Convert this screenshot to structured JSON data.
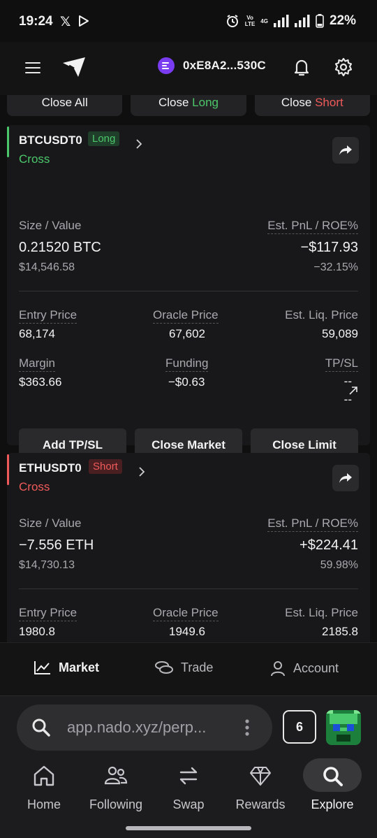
{
  "status_bar": {
    "time": "19:24",
    "x_icon": "x-logo-icon",
    "play_icon": "play-store-icon",
    "volte": "Vo\nLTE",
    "net": "4G",
    "battery": "22%"
  },
  "header": {
    "wallet_address": "0xE8A2...530C"
  },
  "close_bar": {
    "close_all": "Close All",
    "close_long_prefix": "Close ",
    "close_long_suffix": "Long",
    "close_short_prefix": "Close ",
    "close_short_suffix": "Short"
  },
  "positions": [
    {
      "symbol": "BTCUSDT0",
      "side": "Long",
      "margin_mode": "Cross",
      "size_label": "Size / Value",
      "size": "0.21520 BTC",
      "value": "$14,546.58",
      "pnl_label": "Est. PnL / ROE%",
      "pnl": "−$117.93",
      "roe": "−32.15%",
      "entry_label": "Entry Price",
      "entry": "68,174",
      "oracle_label": "Oracle Price",
      "oracle": "67,602",
      "liq_label": "Est. Liq. Price",
      "liq": "59,089",
      "margin_label": "Margin",
      "margin": "$363.66",
      "funding_label": "Funding",
      "funding": "−$0.63",
      "tpsl_label": "TP/SL",
      "tp": "--",
      "sl": "--",
      "add_tpsl": "Add TP/SL",
      "close_market": "Close Market",
      "close_limit": "Close Limit"
    },
    {
      "symbol": "ETHUSDT0",
      "side": "Short",
      "margin_mode": "Cross",
      "size_label": "Size / Value",
      "size": "−7.556 ETH",
      "value": "$14,730.13",
      "pnl_label": "Est. PnL / ROE%",
      "pnl": "+$224.41",
      "roe": "59.98%",
      "entry_label": "Entry Price",
      "entry": "1980.8",
      "oracle_label": "Oracle Price",
      "oracle": "1949.6",
      "liq_label": "Est. Liq. Price",
      "liq": "2185.8"
    }
  ],
  "app_nav": {
    "market": "Market",
    "trade": "Trade",
    "account": "Account"
  },
  "browser": {
    "url": "app.nado.xyz/perp...",
    "tab_count": "6"
  },
  "browser_nav": {
    "home": "Home",
    "following": "Following",
    "swap": "Swap",
    "rewards": "Rewards",
    "explore": "Explore"
  },
  "colors": {
    "long": "#4cc76b",
    "short": "#f05a5a",
    "wallet": "#7a3cf0"
  }
}
